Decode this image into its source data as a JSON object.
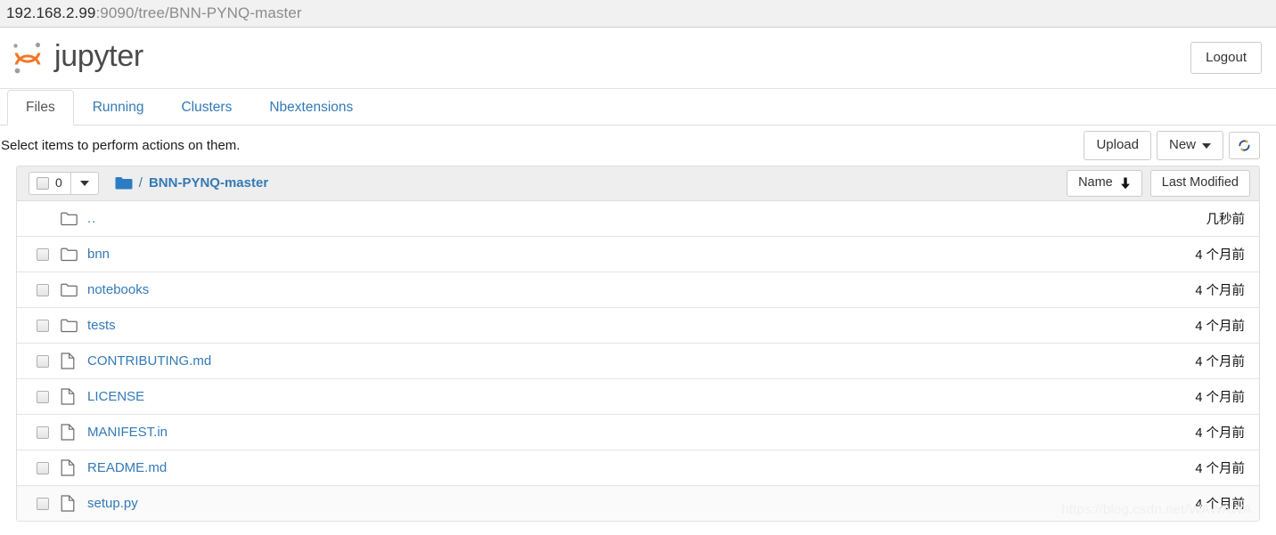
{
  "browser": {
    "url_host": "192.168.2.99",
    "url_rest": ":9090/tree/BNN-PYNQ-master"
  },
  "header": {
    "brand": "jupyter",
    "logo_icon": "jupyter-logo",
    "logout_label": "Logout"
  },
  "tabs": [
    {
      "label": "Files",
      "active": true
    },
    {
      "label": "Running",
      "active": false
    },
    {
      "label": "Clusters",
      "active": false
    },
    {
      "label": "Nbextensions",
      "active": false
    }
  ],
  "toolbar": {
    "select_hint": "Select items to perform actions on them.",
    "upload_label": "Upload",
    "new_label": "New",
    "refresh_icon": "refresh-icon",
    "new_caret_icon": "caret-down-icon"
  },
  "list_header": {
    "select_count": "0",
    "select_all_checkbox_icon": "checkbox-icon",
    "select_all_caret_icon": "caret-down-icon",
    "folder_icon": "folder-icon",
    "path_separator": "/",
    "breadcrumb_label": "BNN-PYNQ-master",
    "sort_name_label": "Name",
    "sort_name_arrow_icon": "arrow-down-icon",
    "sort_name_arrow_glyph": "⬇",
    "sort_modified_label": "Last Modified"
  },
  "colors": {
    "link_blue": "#337ab7",
    "brand_orange": "#f37726",
    "header_bg": "#eeeeee",
    "border": "#dddddd"
  },
  "rows": [
    {
      "name": "..",
      "type": "parent",
      "icon": "folder-outline-icon",
      "modified": "几秒前",
      "has_checkbox": false,
      "shaded": false
    },
    {
      "name": "bnn",
      "type": "folder",
      "icon": "folder-outline-icon",
      "modified": "4 个月前",
      "has_checkbox": true,
      "shaded": false
    },
    {
      "name": "notebooks",
      "type": "folder",
      "icon": "folder-outline-icon",
      "modified": "4 个月前",
      "has_checkbox": true,
      "shaded": false
    },
    {
      "name": "tests",
      "type": "folder",
      "icon": "folder-outline-icon",
      "modified": "4 个月前",
      "has_checkbox": true,
      "shaded": false
    },
    {
      "name": "CONTRIBUTING.md",
      "type": "file",
      "icon": "file-icon",
      "modified": "4 个月前",
      "has_checkbox": true,
      "shaded": false
    },
    {
      "name": "LICENSE",
      "type": "file",
      "icon": "file-icon",
      "modified": "4 个月前",
      "has_checkbox": true,
      "shaded": false
    },
    {
      "name": "MANIFEST.in",
      "type": "file",
      "icon": "file-icon",
      "modified": "4 个月前",
      "has_checkbox": true,
      "shaded": false
    },
    {
      "name": "README.md",
      "type": "file",
      "icon": "file-icon",
      "modified": "4 个月前",
      "has_checkbox": true,
      "shaded": false
    },
    {
      "name": "setup.py",
      "type": "file",
      "icon": "file-icon",
      "modified": "4 个月前",
      "has_checkbox": true,
      "shaded": true
    }
  ],
  "watermark": "https://blog.csdn.net/WAWAWA"
}
